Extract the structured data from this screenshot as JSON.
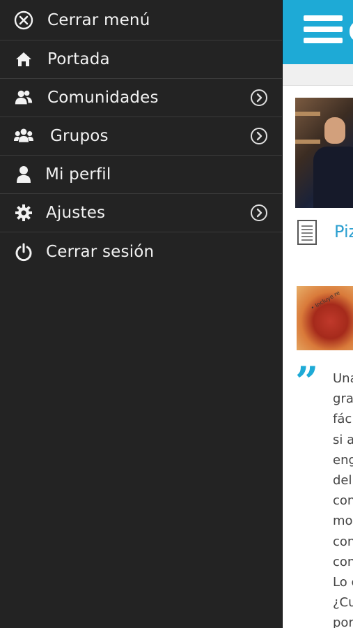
{
  "menu": {
    "items": [
      {
        "label": "Cerrar menú",
        "icon": "close-circle-icon",
        "chevron": false
      },
      {
        "label": "Portada",
        "icon": "home-icon",
        "chevron": false
      },
      {
        "label": "Comunidades",
        "icon": "community-icon",
        "chevron": true
      },
      {
        "label": "Grupos",
        "icon": "groups-icon",
        "chevron": true
      },
      {
        "label": "Mi perfil",
        "icon": "user-icon",
        "chevron": false
      },
      {
        "label": "Ajustes",
        "icon": "gear-icon",
        "chevron": true
      },
      {
        "label": "Cerrar sesión",
        "icon": "power-icon",
        "chevron": false
      }
    ]
  },
  "page": {
    "article_title": "Piz",
    "food_tag": "• Incluye re",
    "quote_lines": [
      "Una",
      "gra",
      "fác",
      "si a",
      "eng",
      "del",
      "con",
      "mo",
      "con",
      "con",
      "Lo c",
      "¿Cu",
      "por"
    ]
  },
  "colors": {
    "menu_bg": "#232323",
    "accent": "#1eaad6",
    "link": "#2b9fd0"
  }
}
